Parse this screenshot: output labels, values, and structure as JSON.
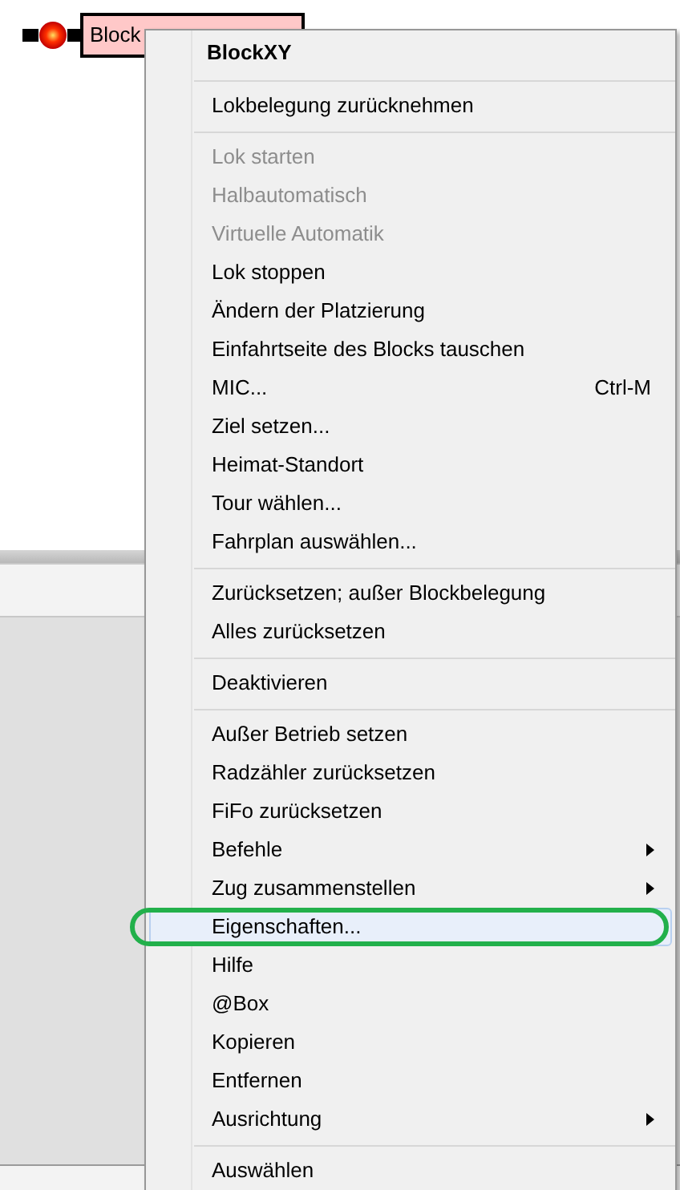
{
  "block": {
    "label": "Block"
  },
  "context_menu": {
    "items": [
      {
        "kind": "header",
        "label": "BlockXY"
      },
      {
        "kind": "separator"
      },
      {
        "kind": "item",
        "label": "Lokbelegung zurücknehmen",
        "disabled": false,
        "selected": false,
        "submenu": false
      },
      {
        "kind": "separator"
      },
      {
        "kind": "item",
        "label": "Lok starten",
        "disabled": true,
        "selected": false,
        "submenu": false
      },
      {
        "kind": "item",
        "label": "Halbautomatisch",
        "disabled": true,
        "selected": false,
        "submenu": false
      },
      {
        "kind": "item",
        "label": "Virtuelle Automatik",
        "disabled": true,
        "selected": false,
        "submenu": false
      },
      {
        "kind": "item",
        "label": "Lok stoppen",
        "disabled": false,
        "selected": false,
        "submenu": false
      },
      {
        "kind": "item",
        "label": "Ändern der Platzierung",
        "disabled": false,
        "selected": false,
        "submenu": false
      },
      {
        "kind": "item",
        "label": "Einfahrtseite des Blocks tauschen",
        "disabled": false,
        "selected": false,
        "submenu": false
      },
      {
        "kind": "item",
        "label": "MIC...",
        "shortcut": "Ctrl-M",
        "disabled": false,
        "selected": false,
        "submenu": false
      },
      {
        "kind": "item",
        "label": "Ziel setzen...",
        "disabled": false,
        "selected": false,
        "submenu": false
      },
      {
        "kind": "item",
        "label": "Heimat-Standort",
        "disabled": false,
        "selected": false,
        "submenu": false
      },
      {
        "kind": "item",
        "label": "Tour wählen...",
        "disabled": false,
        "selected": false,
        "submenu": false
      },
      {
        "kind": "item",
        "label": "Fahrplan auswählen...",
        "disabled": false,
        "selected": false,
        "submenu": false
      },
      {
        "kind": "separator"
      },
      {
        "kind": "item",
        "label": "Zurücksetzen; außer Blockbelegung",
        "disabled": false,
        "selected": false,
        "submenu": false
      },
      {
        "kind": "item",
        "label": "Alles zurücksetzen",
        "disabled": false,
        "selected": false,
        "submenu": false
      },
      {
        "kind": "separator"
      },
      {
        "kind": "item",
        "label": "Deaktivieren",
        "disabled": false,
        "selected": false,
        "submenu": false
      },
      {
        "kind": "separator"
      },
      {
        "kind": "item",
        "label": "Außer Betrieb setzen",
        "disabled": false,
        "selected": false,
        "submenu": false
      },
      {
        "kind": "item",
        "label": "Radzähler zurücksetzen",
        "disabled": false,
        "selected": false,
        "submenu": false
      },
      {
        "kind": "item",
        "label": "FiFo zurücksetzen",
        "disabled": false,
        "selected": false,
        "submenu": false
      },
      {
        "kind": "item",
        "label": "Befehle",
        "disabled": false,
        "selected": false,
        "submenu": true
      },
      {
        "kind": "item",
        "label": "Zug zusammenstellen",
        "disabled": false,
        "selected": false,
        "submenu": true
      },
      {
        "kind": "item",
        "label": "Eigenschaften...",
        "disabled": false,
        "selected": true,
        "submenu": false,
        "annotated": true
      },
      {
        "kind": "item",
        "label": "Hilfe",
        "disabled": false,
        "selected": false,
        "submenu": false
      },
      {
        "kind": "item",
        "label": "@Box",
        "disabled": false,
        "selected": false,
        "submenu": false
      },
      {
        "kind": "item",
        "label": "Kopieren",
        "disabled": false,
        "selected": false,
        "submenu": false
      },
      {
        "kind": "item",
        "label": "Entfernen",
        "disabled": false,
        "selected": false,
        "submenu": false
      },
      {
        "kind": "item",
        "label": "Ausrichtung",
        "disabled": false,
        "selected": false,
        "submenu": true
      },
      {
        "kind": "separator"
      },
      {
        "kind": "item",
        "label": "Auswählen",
        "disabled": false,
        "selected": false,
        "submenu": false
      }
    ]
  }
}
